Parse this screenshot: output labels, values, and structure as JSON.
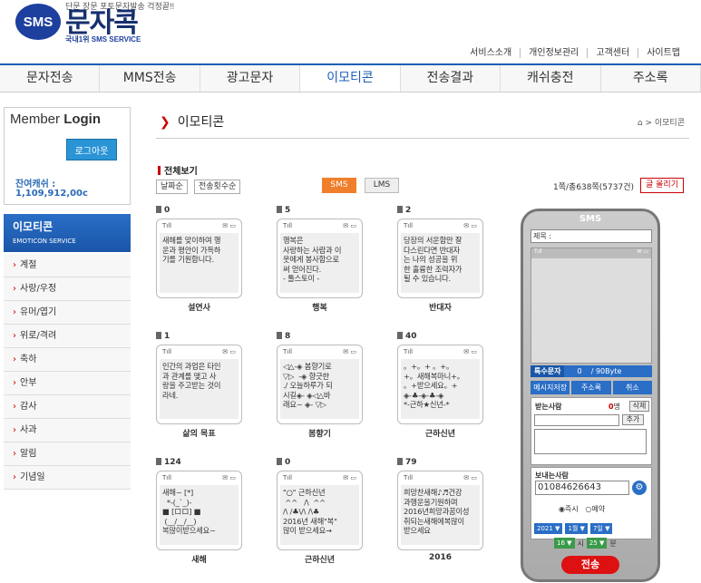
{
  "header": {
    "logo_badge": "SMS",
    "logo_name": "문자콕",
    "logo_tagline": "단문 장문 포토문자발송 걱정끝!!",
    "logo_sub": "국내1위 SMS SERVICE",
    "top_links": [
      "서비스소개",
      "개인정보관리",
      "고객센터",
      "사이트맵"
    ]
  },
  "nav": {
    "items": [
      "문자전송",
      "MMS전송",
      "광고문자",
      "이모티콘",
      "전송결과",
      "캐쉬충전",
      "주소록"
    ],
    "active": "이모티콘"
  },
  "sidebar": {
    "login_title_light": "Member",
    "login_title_bold": "Login",
    "logout_label": "로그아웃",
    "balance_label": "잔여캐쉬 :",
    "balance_value": "1,109,912,00c",
    "category_title": "이모티콘",
    "category_sub": "EMOTICON SERVICE",
    "categories": [
      "계절",
      "사랑/우정",
      "유머/엽기",
      "위로/격려",
      "축하",
      "안부",
      "감사",
      "사과",
      "알림",
      "기념일"
    ]
  },
  "main": {
    "title": "이모티콘",
    "breadcrumb": "⌂ > 이모티콘",
    "section_label": "전체보기",
    "sort_buttons": [
      "날짜순",
      "전송횟수순"
    ],
    "type_sms": "SMS",
    "type_lms": "LMS",
    "page_info": "1쪽/총638쪽(5737건)",
    "upload_label": "글 올리기",
    "cards": [
      {
        "count": "0",
        "label": "설연사",
        "text": "새해를 맞이하여 행\n운과 평안이 가득하\n기를 기원합니다."
      },
      {
        "count": "5",
        "label": "행복",
        "text": "행복은\n사랑하는 사람과 이\n웃에게 봉사함으로\n써 얻어진다.\n- 톨스토이 -"
      },
      {
        "count": "2",
        "label": "반대자",
        "text": "당장의 서운함만 잘\n다스린다면 반대자\n는 나의 성공을 위\n한 훌륭한 조력자가\n될 수 있습니다."
      },
      {
        "count": "1",
        "label": "삶의 목표",
        "text": "인간의 과업은 타인\n과 관계를 맺고 사\n랑을 주고받는 것이\n라네."
      },
      {
        "count": "8",
        "label": "봄향기",
        "text": "◁△-◈ 봄향기로\n▽▷  -◈ 향긋한\n./ 오늘하루가 되\n시길◈- ◈◁△바\n래요~ ◈- ▽▷"
      },
      {
        "count": "40",
        "label": "근하신년",
        "text": "。+。+ 。+。\n+。새해복마니+。\n。+받으세요。+\n◈-♣-◈-♣-◈\n*-근하★신년-*"
      },
      {
        "count": "124",
        "label": "새해",
        "text": "새해~ [*]\n  *-(_`_)-\n■ [ロロ] ■\n (__/__/__)\n복많이받으세요~"
      },
      {
        "count": "0",
        "label": "근하신년",
        "text": "\"○\" 근하신년\n ^^   /\\  ^^\n/\\ /♣\\/\\ /\\♣\n2016년 새해\"복\"\n많이 받으세요→"
      },
      {
        "count": "79",
        "label": "2016",
        "text": "희망찬새해♪♬건강\n과행운을기원하며\n2016년희망과꿈이성\n취되는새해에복많이\n받으세요"
      }
    ]
  },
  "phone": {
    "title": "SMS",
    "subject_label": "제목 :",
    "status_left": "Tıll",
    "status_right": "✉ ▭",
    "counter_label": "특수문자",
    "counter_value": "0",
    "counter_max": "/ 90Byte",
    "save_label": "메시지저장",
    "address_label": "주소록",
    "cancel_label": "취소",
    "recv_label": "받는사람",
    "recv_count_num": "0",
    "recv_count_unit": "명",
    "delete_label": "삭제",
    "add_label": "추가",
    "send_label": "보내는사람",
    "send_number": "01084626643",
    "radio_now": "즉시",
    "radio_reserve": "예약",
    "year": "2021 ▼",
    "month": "1월 ▼",
    "day": "7일 ▼",
    "hour": "16 ▼",
    "hour_unit": "시",
    "minute": "25 ▼",
    "minute_unit": "분",
    "send_button": "전송"
  }
}
